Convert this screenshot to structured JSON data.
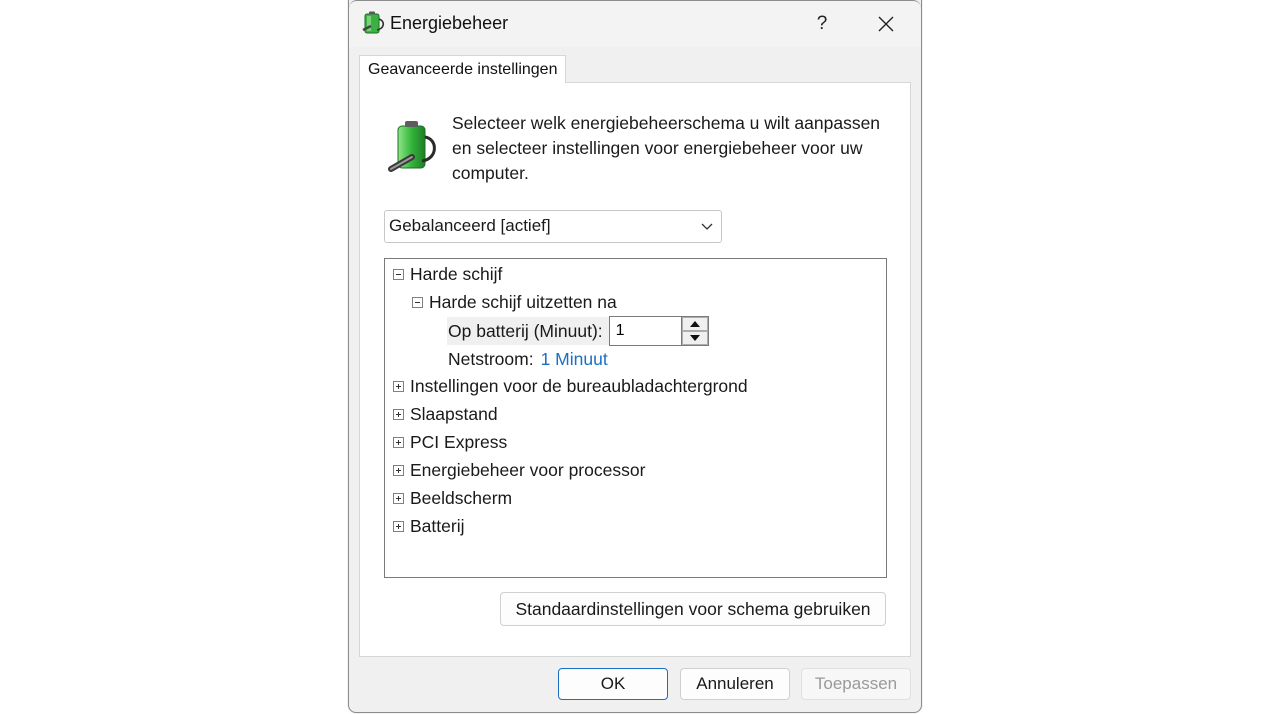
{
  "window": {
    "title": "Energiebeheer",
    "help_label": "?",
    "title_icon": "power-battery-icon",
    "close_icon": "close-icon"
  },
  "tabs": [
    {
      "label": "Geavanceerde instellingen"
    }
  ],
  "panel": {
    "icon": "power-battery-icon",
    "description": "Selecteer welk energiebeheerschema u wilt aanpassen en selecteer instellingen voor energiebeheer voor uw computer.",
    "scheme_select": {
      "value": "Gebalanceerd [actief]",
      "icon": "chevron-down-icon"
    }
  },
  "tree": {
    "items": [
      {
        "label": "Harde schijf",
        "expanded": true
      },
      {
        "label": "Harde schijf uitzetten na",
        "expanded": true
      },
      {
        "label": "Instellingen voor de bureaubladachtergrond",
        "expanded": false
      },
      {
        "label": "Slaapstand",
        "expanded": false
      },
      {
        "label": "PCI Express",
        "expanded": false
      },
      {
        "label": "Energiebeheer voor processor",
        "expanded": false
      },
      {
        "label": "Beeldscherm",
        "expanded": false
      },
      {
        "label": "Batterij",
        "expanded": false
      }
    ],
    "battery_setting": {
      "label": "Op batterij (Minuut):",
      "value": "1"
    },
    "plugged_setting": {
      "label": "Netstroom:",
      "value": "1 Minuut"
    }
  },
  "buttons": {
    "defaults": "Standaardinstellingen voor schema gebruiken",
    "ok": "OK",
    "cancel": "Annuleren",
    "apply": "Toepassen"
  },
  "colors": {
    "accent": "#1a6fc4",
    "battery_green": "#3cb043"
  }
}
